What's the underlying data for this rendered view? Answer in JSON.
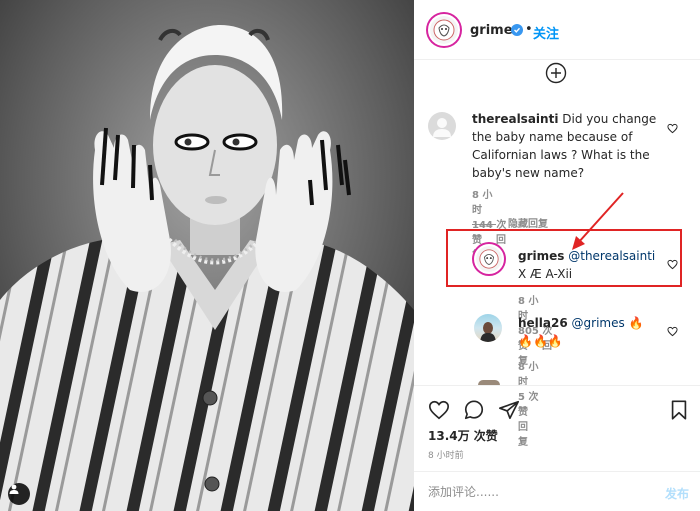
{
  "post": {
    "username": "grimes",
    "follow_label": "关注",
    "dot": "•"
  },
  "comments": [
    {
      "username": "therealsainti",
      "text": " Did you change the baby name because of Californian laws ? What is the baby's new name?",
      "time": "8 小时",
      "likes": "144 次赞",
      "reply": "回复"
    }
  ],
  "hide_replies": "隐藏回复",
  "replies": [
    {
      "username": "grimes",
      "mention": "@therealsainti",
      "text": " X Æ A-Xii",
      "time": "8 小时",
      "likes": "805 次赞",
      "reply": "回复"
    },
    {
      "username": "hella26",
      "mention": "@grimes",
      "text": " 🔥🔥🔥🔥",
      "time": "8 小时",
      "likes": "5 次赞",
      "reply": "回复"
    }
  ],
  "likes_total": "13.4万 次赞",
  "post_time": "8 小时前",
  "composer": {
    "placeholder": "添加评论......",
    "post_label": "发布"
  },
  "colors": {
    "accent_blue": "#0095f6",
    "verified_blue": "#3897f0",
    "highlight_red": "#e02424",
    "arrow_red": "#e02424"
  },
  "icons": [
    "tag-user-icon",
    "verified-badge-icon",
    "add-circle-icon",
    "heart-icon",
    "comment-icon",
    "share-icon",
    "bookmark-icon"
  ]
}
